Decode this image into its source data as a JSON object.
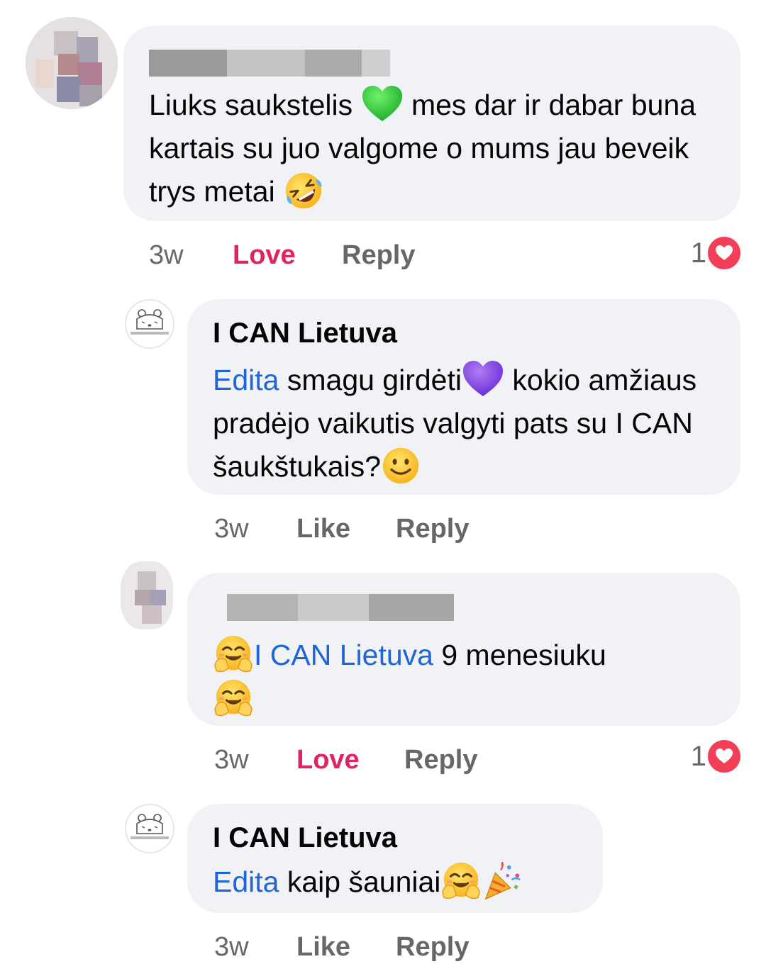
{
  "comments": [
    {
      "author_redacted": true,
      "text": "Liuks saukstelis",
      "text_2": "mes dar ir dabar buna kartais su juo valgome o mums jau beveik trys metai",
      "emoji_1": "green-heart-icon",
      "emoji_2": "rolling-on-floor-laughing-icon",
      "time": "3w",
      "reaction_label": "Love",
      "reply_label": "Reply",
      "reaction_count": "1",
      "reaction_icon": "love-heart-icon"
    },
    {
      "author": "I CAN Lietuva",
      "mention": "Edita",
      "text": "smagu girdėti",
      "text_2": "kokio amžiaus pradėjo vaikutis valgyti pats su I CAN šaukštukais?",
      "emoji_1": "purple-heart-icon",
      "emoji_2": "smiling-face-icon",
      "time": "3w",
      "reaction_label": "Like",
      "reply_label": "Reply"
    },
    {
      "author_redacted": true,
      "mention": "I CAN Lietuva",
      "text": "9 menesiuku",
      "emoji_1": "hugging-face-icon",
      "emoji_2": "hugging-face-icon",
      "time": "3w",
      "reaction_label": "Love",
      "reply_label": "Reply",
      "reaction_count": "1",
      "reaction_icon": "love-heart-icon"
    },
    {
      "author": "I CAN Lietuva",
      "mention": "Edita",
      "text": "kaip šauniai",
      "emoji_1": "hugging-face-icon",
      "emoji_2": "party-popper-icon",
      "time": "3w",
      "reaction_label": "Like",
      "reply_label": "Reply"
    }
  ],
  "colors": {
    "bubble": "#f0f2f5",
    "mention": "#1f65d6",
    "love": "#e0245e",
    "meta": "#65676b",
    "heart_badge": "#f33e58"
  }
}
